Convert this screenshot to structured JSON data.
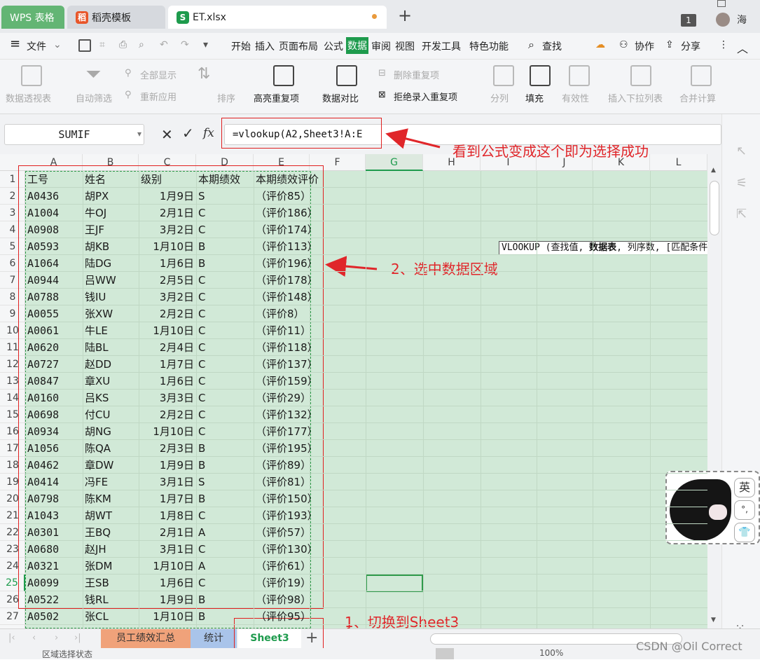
{
  "tabs": {
    "wps": "WPS 表格",
    "daoke": "稻壳模板",
    "file": "ET.xlsx",
    "plus": "+",
    "badge": "1",
    "user": "海"
  },
  "menu": {
    "file": "文件",
    "items": [
      "开始",
      "插入",
      "页面布局",
      "公式",
      "数据",
      "审阅",
      "视图",
      "开发工具",
      "特色功能"
    ],
    "active": "数据",
    "search": "查找",
    "collab": "协作",
    "share": "分享"
  },
  "toolbar": {
    "pivot": "数据透视表",
    "autofilter": "自动筛选",
    "showall": "全部显示",
    "reapply": "重新应用",
    "sort": "排序",
    "highlight_dup": "高亮重复项",
    "compare": "数据对比",
    "remove_dup": "删除重复项",
    "reject_dup": "拒绝录入重复项",
    "split": "分列",
    "fill": "填充",
    "validity": "有效性",
    "insert_dropdown": "插入下拉列表",
    "merge_calc": "合并计算"
  },
  "formula": {
    "namebox": "SUMIF",
    "fx": "fx",
    "text": "=vlookup(A2,Sheet3!A:E"
  },
  "tooltip": "VLOOKUP (查找值, 数据表, 列序数, [匹配条件",
  "tooltip_bold": "数据表",
  "annotations": {
    "top": "看到公式变成这个即为选择成功",
    "middle": "2、选中数据区域",
    "bottom": "1、切换到Sheet3"
  },
  "columns": [
    "A",
    "B",
    "C",
    "D",
    "E",
    "F",
    "G",
    "H",
    "I",
    "J",
    "K",
    "L"
  ],
  "header_row": [
    "工号",
    "姓名",
    "级别",
    "本期绩效",
    "本期绩效评价"
  ],
  "rows": [
    [
      "A0436",
      "胡PX",
      "1月9日",
      "S",
      "（评价85）"
    ],
    [
      "A1004",
      "牛OJ",
      "2月1日",
      "C",
      "（评价186）"
    ],
    [
      "A0908",
      "王JF",
      "3月2日",
      "C",
      "（评价174）"
    ],
    [
      "A0593",
      "胡KB",
      "1月10日",
      "B",
      "（评价113）"
    ],
    [
      "A1064",
      "陆DG",
      "1月6日",
      "B",
      "（评价196）"
    ],
    [
      "A0944",
      "吕WW",
      "2月5日",
      "C",
      "（评价178）"
    ],
    [
      "A0788",
      "钱IU",
      "3月2日",
      "C",
      "（评价148）"
    ],
    [
      "A0055",
      "张XW",
      "2月2日",
      "C",
      "（评价8）"
    ],
    [
      "A0061",
      "牛LE",
      "1月10日",
      "C",
      "（评价11）"
    ],
    [
      "A0620",
      "陆BL",
      "2月4日",
      "C",
      "（评价118）"
    ],
    [
      "A0727",
      "赵DD",
      "1月7日",
      "C",
      "（评价137）"
    ],
    [
      "A0847",
      "章XU",
      "1月6日",
      "C",
      "（评价159）"
    ],
    [
      "A0160",
      "吕KS",
      "3月3日",
      "C",
      "（评价29）"
    ],
    [
      "A0698",
      "付CU",
      "2月2日",
      "C",
      "（评价132）"
    ],
    [
      "A0934",
      "胡NG",
      "1月10日",
      "C",
      "（评价177）"
    ],
    [
      "A1056",
      "陈QA",
      "2月3日",
      "B",
      "（评价195）"
    ],
    [
      "A0462",
      "章DW",
      "1月9日",
      "B",
      "（评价89）"
    ],
    [
      "A0414",
      "冯FE",
      "3月1日",
      "S",
      "（评价81）"
    ],
    [
      "A0798",
      "陈KM",
      "1月7日",
      "B",
      "（评价150）"
    ],
    [
      "A1043",
      "胡WT",
      "1月8日",
      "C",
      "（评价193）"
    ],
    [
      "A0301",
      "王BQ",
      "2月1日",
      "A",
      "（评价57）"
    ],
    [
      "A0680",
      "赵JH",
      "3月1日",
      "C",
      "（评价130）"
    ],
    [
      "A0321",
      "张DM",
      "1月10日",
      "A",
      "（评价61）"
    ],
    [
      "A0099",
      "王SB",
      "1月6日",
      "C",
      "（评价19）"
    ],
    [
      "A0522",
      "钱RL",
      "1月9日",
      "B",
      "（评价98）"
    ],
    [
      "A0502",
      "张CL",
      "1月10日",
      "B",
      "（评价95）"
    ]
  ],
  "sheets": [
    "员工绩效汇总",
    "统计",
    "Sheet3"
  ],
  "active_sheet": "Sheet3",
  "ime": {
    "lang": "英",
    "punct": "°,",
    "skin": "👕"
  },
  "status": {
    "mode": "区域选择状态",
    "zoom": "100%",
    "watermark": "CSDN @Oil Correct"
  },
  "colors": {
    "selection": "#d1e9d7",
    "annotation": "#e0262a",
    "active_tab": "#1e9b4d",
    "wps_green": "#63b574"
  }
}
